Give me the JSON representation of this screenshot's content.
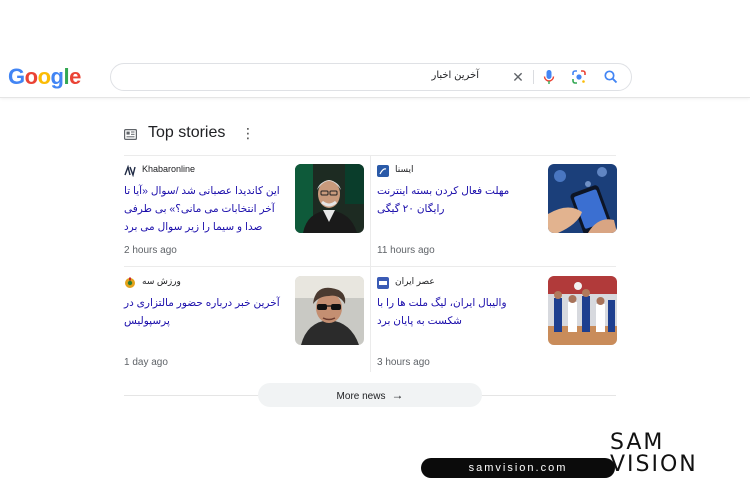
{
  "logo": {
    "text": "Google",
    "letters": [
      "G",
      "o",
      "o",
      "g",
      "l",
      "e"
    ],
    "colors": [
      "#4285f4",
      "#ea4335",
      "#fbbc05",
      "#4285f4",
      "#34a853",
      "#ea4335"
    ]
  },
  "search": {
    "query": "آخرین اخبار"
  },
  "icons": {
    "clear": "close-icon",
    "mic": "mic-icon",
    "lens": "lens-icon",
    "search": "search-icon",
    "news": "newspaper-icon",
    "more": "more-vert-icon",
    "arrow": "arrow-right-icon"
  },
  "top_stories": {
    "title": "Top stories",
    "more_label": "More news",
    "cards": [
      {
        "source": "Khabaronline",
        "headline": "این کاندیدا عصبانی شد /سوال «آیا تا آخر انتخابات می مانی؟» بی طرفی صدا و سیما را زیر سوال می برد",
        "time": "2 hours ago",
        "accent": "#1f2a44"
      },
      {
        "source": "ایسنا",
        "headline": "مهلت فعال کردن بسته اینترنت رایگان ۲۰ گیگی",
        "time": "11 hours ago",
        "accent": "#2a5aa8"
      },
      {
        "source": "ورزش سه",
        "headline": "آخرین خبر درباره حضور مالتزاری در پرسپولیس",
        "time": "1 day ago",
        "accent": "#e3a21a"
      },
      {
        "source": "عصر ایران",
        "headline": "والیبال ایران، لیگ ملت ها را با شکست به پایان برد",
        "time": "3 hours ago",
        "accent": "#3a5bb5"
      }
    ]
  },
  "brand": {
    "name": "SAM VISION",
    "url": "samvision.com",
    "color": "#111111"
  }
}
